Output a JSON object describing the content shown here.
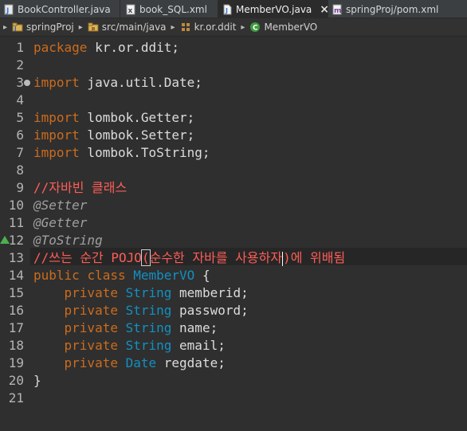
{
  "tabs": [
    {
      "label": "BookController.java",
      "icon": "java-class-icon",
      "active": false
    },
    {
      "label": "book_SQL.xml",
      "icon": "xml-file-icon",
      "active": false
    },
    {
      "label": "MemberVO.java",
      "icon": "java-file-icon",
      "active": true,
      "close": "×"
    },
    {
      "label": "springProj/pom.xml",
      "icon": "maven-pom-icon",
      "active": false
    }
  ],
  "breadcrumb": [
    {
      "label": "springProj",
      "icon": "project-icon"
    },
    {
      "label": "src/main/java",
      "icon": "source-folder-icon"
    },
    {
      "label": "kr.or.ddit",
      "icon": "package-icon"
    },
    {
      "label": "MemberVO",
      "icon": "class-icon"
    }
  ],
  "line_numbers": [
    "1",
    "2",
    "3",
    "4",
    "5",
    "6",
    "7",
    "8",
    "9",
    "10",
    "11",
    "12",
    "13",
    "14",
    "15",
    "16",
    "17",
    "18",
    "19",
    "20",
    "21"
  ],
  "code": {
    "l1_kw": "package",
    "l1_rest": " kr.or.ddit;",
    "l3_kw": "import",
    "l3_rest": " java.util.Date;",
    "l5_kw": "import",
    "l5_rest": " lombok.Getter;",
    "l6_kw": "import",
    "l6_rest": " lombok.Setter;",
    "l7_kw": "import",
    "l7_rest": " lombok.ToString;",
    "l9": "//자바빈 클래스",
    "l10": "@Setter",
    "l11": "@Getter",
    "l12": "@ToString",
    "l13_a": "//쓰는 순간 POJO",
    "l13_b": "(",
    "l13_c": "순수한 자바를 사용하자",
    "l13_d": ")",
    "l13_e": "에 위배됨",
    "l14_kw1": "public",
    "l14_kw2": "class",
    "l14_type": "MemberVO",
    "l14_rest": " {",
    "fields": [
      {
        "kw": "private",
        "type": "String",
        "name": " memberid;"
      },
      {
        "kw": "private",
        "type": "String",
        "name": " password;"
      },
      {
        "kw": "private",
        "type": "String",
        "name": " name;"
      },
      {
        "kw": "private",
        "type": "String",
        "name": " email;"
      },
      {
        "kw": "private",
        "type": "Date",
        "name": " regdate;"
      }
    ],
    "l20": "}"
  },
  "colors": {
    "keyword": "#cc6c1d",
    "type": "#1290c3",
    "comment": "#ff5d57",
    "annotation": "#a0a0a0",
    "text": "#dcdcdc",
    "background": "#2f2f2f"
  }
}
